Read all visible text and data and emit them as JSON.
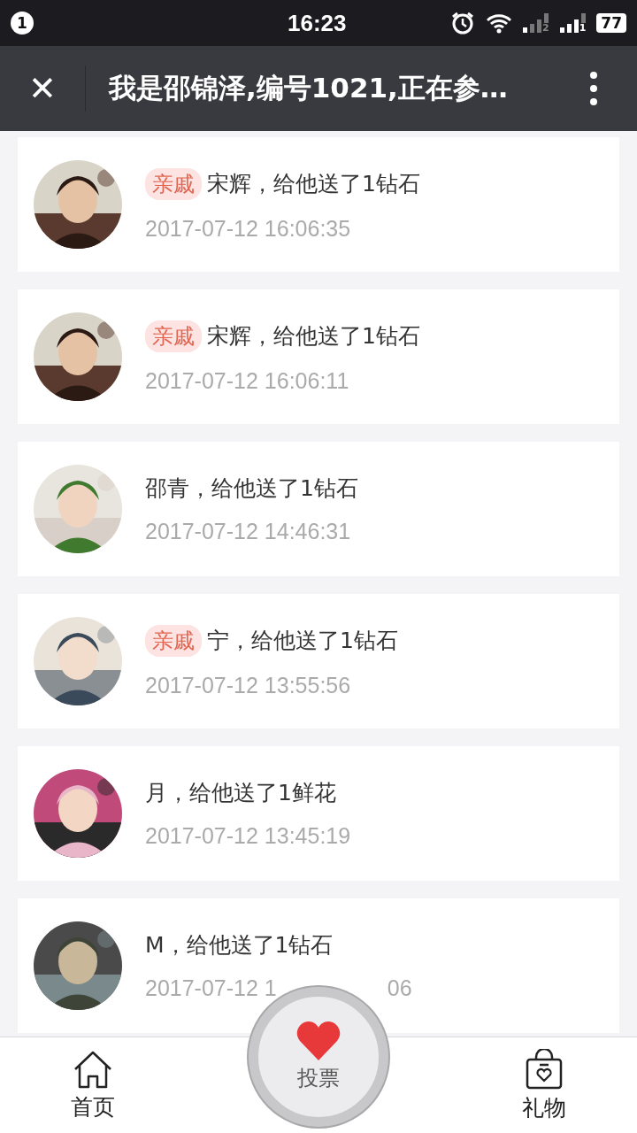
{
  "status_bar": {
    "notification_count": "1",
    "time": "16:23",
    "sim_1": "2",
    "sim_2": "1",
    "battery": "77"
  },
  "header": {
    "close": "✕",
    "title": "我是邵锦泽,编号1021,正在参…"
  },
  "records": [
    {
      "tag": "亲戚",
      "text": "宋辉，给他送了1钻石",
      "time": "2017-07-12 16:06:35"
    },
    {
      "tag": "亲戚",
      "text": "宋辉，给他送了1钻石",
      "time": "2017-07-12 16:06:11"
    },
    {
      "text": "邵青，给他送了1钻石",
      "time": "2017-07-12 14:46:31"
    },
    {
      "tag": "亲戚",
      "text": "宁，给他送了1钻石",
      "time": "2017-07-12 13:55:56"
    },
    {
      "text": "月，给他送了1鲜花",
      "time": "2017-07-12 13:45:19"
    },
    {
      "text": "M，给他送了1钻石",
      "time": "2017-07-12 1",
      "time_end": "06"
    }
  ],
  "bottom_nav": {
    "home": "首页",
    "vote": "投票",
    "gifts": "礼物"
  }
}
